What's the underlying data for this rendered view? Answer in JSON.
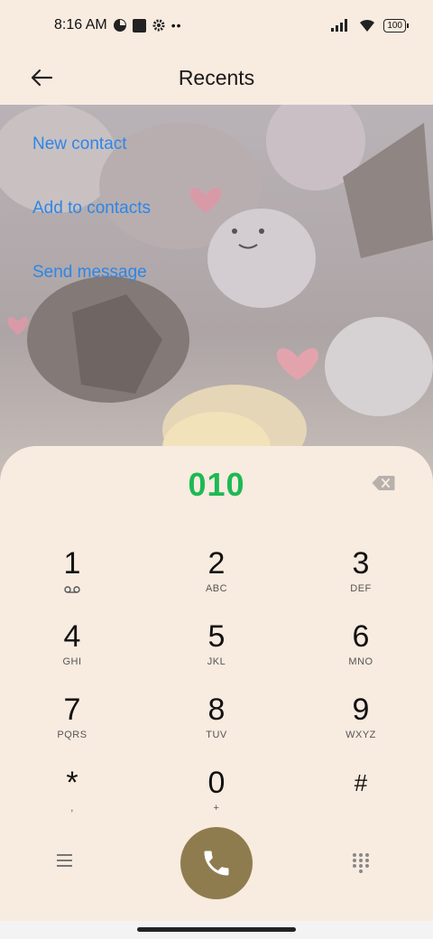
{
  "status_bar": {
    "time": "8:16 AM",
    "battery": "100"
  },
  "header": {
    "title": "Recents"
  },
  "actions": [
    {
      "label": "New contact"
    },
    {
      "label": "Add to contacts"
    },
    {
      "label": "Send message"
    }
  ],
  "dialer": {
    "number": "010",
    "keys": [
      {
        "digit": "1",
        "letters": ""
      },
      {
        "digit": "2",
        "letters": "ABC"
      },
      {
        "digit": "3",
        "letters": "DEF"
      },
      {
        "digit": "4",
        "letters": "GHI"
      },
      {
        "digit": "5",
        "letters": "JKL"
      },
      {
        "digit": "6",
        "letters": "MNO"
      },
      {
        "digit": "7",
        "letters": "PQRS"
      },
      {
        "digit": "8",
        "letters": "TUV"
      },
      {
        "digit": "9",
        "letters": "WXYZ"
      },
      {
        "digit": "*",
        "letters": ","
      },
      {
        "digit": "0",
        "letters": "+"
      },
      {
        "digit": "#",
        "letters": ""
      }
    ]
  },
  "colors": {
    "background": "#f8ebe0",
    "link": "#2d86e6",
    "number": "#1db954",
    "call_button": "#8f7c4e"
  },
  "icons": {
    "back": "arrow-left-icon",
    "backspace": "backspace-icon",
    "menu": "menu-icon",
    "call": "phone-icon",
    "dialpad": "dialpad-icon",
    "voicemail": "voicemail-icon"
  }
}
